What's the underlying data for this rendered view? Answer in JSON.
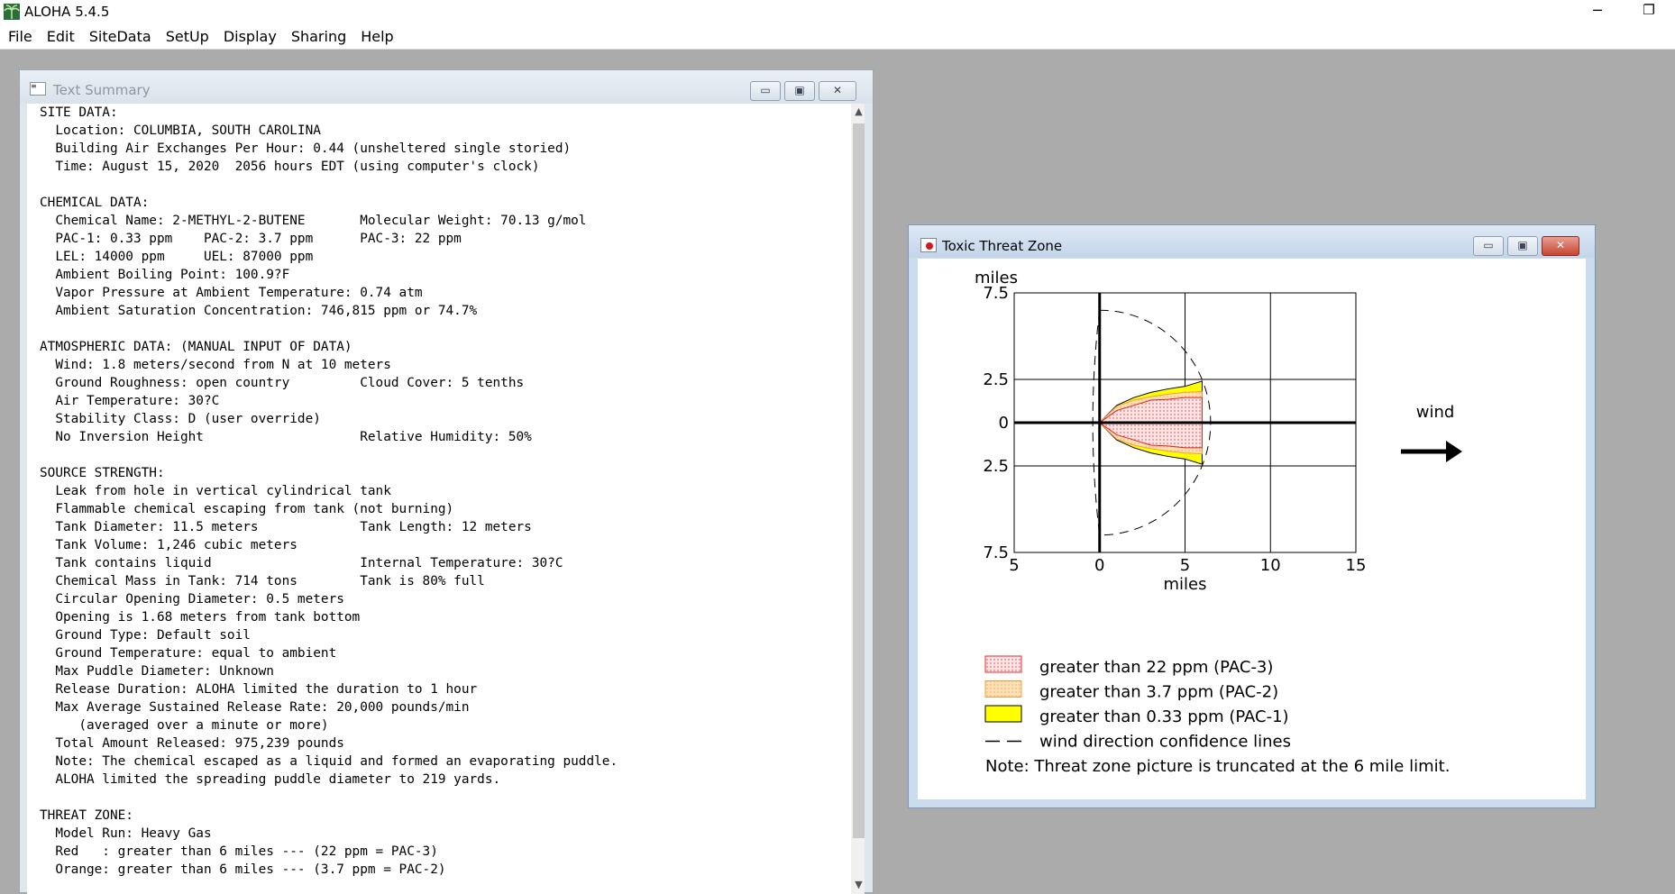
{
  "app": {
    "title": "ALOHA 5.4.5",
    "menu": [
      "File",
      "Edit",
      "SiteData",
      "SetUp",
      "Display",
      "Sharing",
      "Help"
    ],
    "window_controls": {
      "minimize": "─",
      "restore": "❐"
    }
  },
  "text_summary": {
    "title": "Text Summary",
    "icon": "document-icon",
    "lines": [
      "SITE DATA:",
      "  Location: COLUMBIA, SOUTH CAROLINA",
      "  Building Air Exchanges Per Hour: 0.44 (unsheltered single storied)",
      "  Time: August 15, 2020  2056 hours EDT (using computer's clock)",
      "",
      "CHEMICAL DATA:",
      "  Chemical Name: 2-METHYL-2-BUTENE       Molecular Weight: 70.13 g/mol",
      "  PAC-1: 0.33 ppm    PAC-2: 3.7 ppm      PAC-3: 22 ppm",
      "  LEL: 14000 ppm     UEL: 87000 ppm",
      "  Ambient Boiling Point: 100.9?F",
      "  Vapor Pressure at Ambient Temperature: 0.74 atm",
      "  Ambient Saturation Concentration: 746,815 ppm or 74.7%",
      "",
      "ATMOSPHERIC DATA: (MANUAL INPUT OF DATA)",
      "  Wind: 1.8 meters/second from N at 10 meters",
      "  Ground Roughness: open country         Cloud Cover: 5 tenths",
      "  Air Temperature: 30?C",
      "  Stability Class: D (user override)",
      "  No Inversion Height                    Relative Humidity: 50%",
      "",
      "SOURCE STRENGTH:",
      "  Leak from hole in vertical cylindrical tank",
      "  Flammable chemical escaping from tank (not burning)",
      "  Tank Diameter: 11.5 meters             Tank Length: 12 meters",
      "  Tank Volume: 1,246 cubic meters",
      "  Tank contains liquid                   Internal Temperature: 30?C",
      "  Chemical Mass in Tank: 714 tons        Tank is 80% full",
      "  Circular Opening Diameter: 0.5 meters",
      "  Opening is 1.68 meters from tank bottom",
      "  Ground Type: Default soil",
      "  Ground Temperature: equal to ambient",
      "  Max Puddle Diameter: Unknown",
      "  Release Duration: ALOHA limited the duration to 1 hour",
      "  Max Average Sustained Release Rate: 20,000 pounds/min",
      "     (averaged over a minute or more)",
      "  Total Amount Released: 975,239 pounds",
      "  Note: The chemical escaped as a liquid and formed an evaporating puddle.",
      "  ALOHA limited the spreading puddle diameter to 219 yards.",
      "",
      "THREAT ZONE:",
      "  Model Run: Heavy Gas",
      "  Red   : greater than 6 miles --- (22 ppm = PAC-3)",
      "  Orange: greater than 6 miles --- (3.7 ppm = PAC-2)"
    ]
  },
  "threat_zone": {
    "title": "Toxic Threat Zone",
    "icon": "threat-zone-icon",
    "wind_label": "wind",
    "note": "Note: Threat zone picture is truncated at the 6 mile limit.",
    "legend": [
      {
        "label": "greater than 22 ppm (PAC-3)",
        "color": "#f4c8c8",
        "stroke": "#e03030"
      },
      {
        "label": "greater than 3.7 ppm (PAC-2)",
        "color": "#fbd8a8",
        "stroke": "#f0a040"
      },
      {
        "label": "greater than 0.33 ppm (PAC-1)",
        "color": "#ffff00",
        "stroke": "#000000"
      },
      {
        "label": "wind direction confidence lines",
        "color": "none",
        "stroke": "#000000"
      }
    ],
    "chart_data": {
      "type": "area",
      "xlabel": "miles",
      "ylabel": "miles",
      "xlim": [
        -5,
        15
      ],
      "ylim": [
        -7.5,
        7.5
      ],
      "x_ticks": [
        "5",
        "0",
        "5",
        "10",
        "15"
      ],
      "x_tick_values": [
        -5,
        0,
        5,
        10,
        15
      ],
      "y_ticks": [
        "7.5",
        "2.5",
        "0",
        "2.5",
        "7.5"
      ],
      "y_tick_values": [
        7.5,
        2.5,
        0,
        -2.5,
        -7.5
      ],
      "grid": true,
      "truncation_x": 6,
      "series": [
        {
          "name": "greater than 0.33 ppm (PAC-1)",
          "points": [
            [
              0,
              0
            ],
            [
              1,
              1.0
            ],
            [
              2,
              1.45
            ],
            [
              3,
              1.75
            ],
            [
              4,
              1.95
            ],
            [
              5,
              2.1
            ],
            [
              6,
              2.4
            ]
          ]
        },
        {
          "name": "greater than 3.7 ppm (PAC-2)",
          "points": [
            [
              0,
              0
            ],
            [
              1,
              0.95
            ],
            [
              2,
              1.3
            ],
            [
              3,
              1.5
            ],
            [
              4,
              1.65
            ],
            [
              5,
              1.75
            ],
            [
              6,
              1.8
            ]
          ]
        },
        {
          "name": "greater than 22 ppm (PAC-3)",
          "points": [
            [
              0,
              0
            ],
            [
              1,
              0.7
            ],
            [
              2,
              1.0
            ],
            [
              3,
              1.3
            ],
            [
              4,
              1.35
            ],
            [
              5,
              1.45
            ],
            [
              6,
              1.45
            ]
          ]
        }
      ],
      "confidence_radius": 6.5
    }
  }
}
